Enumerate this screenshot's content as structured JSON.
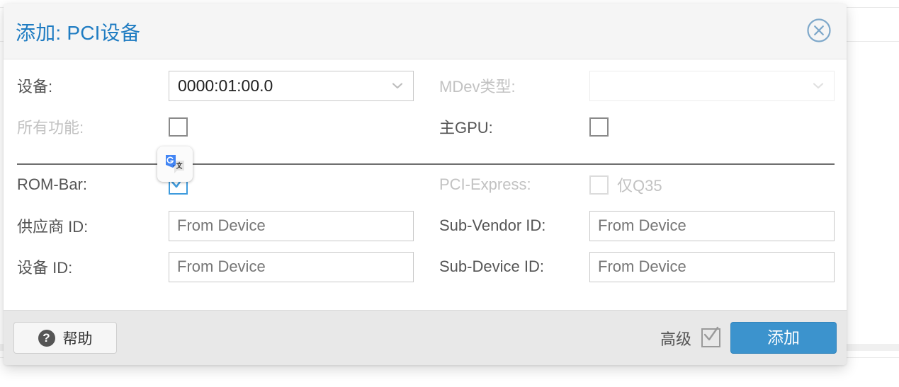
{
  "dialog": {
    "title": "添加: PCI设备",
    "close_icon": "close-circle-icon"
  },
  "form": {
    "device": {
      "label": "设备:",
      "value": "0000:01:00.0",
      "caret_icon": "chevron-down-icon"
    },
    "mdev_type": {
      "label": "MDev类型:",
      "value": "",
      "caret_icon": "chevron-down-icon"
    },
    "all_functions": {
      "label": "所有功能:",
      "checked": false
    },
    "primary_gpu": {
      "label": "主GPU:",
      "checked": false
    },
    "rom_bar": {
      "label": "ROM-Bar:",
      "checked": true
    },
    "pci_express": {
      "label": "PCI-Express:",
      "suffix": "仅Q35",
      "checked": false
    },
    "vendor_id": {
      "label": "供应商 ID:",
      "value": "",
      "placeholder": "From Device"
    },
    "sub_vendor_id": {
      "label": "Sub-Vendor ID:",
      "value": "",
      "placeholder": "From Device"
    },
    "device_id": {
      "label": "设备 ID:",
      "value": "",
      "placeholder": "From Device"
    },
    "sub_device_id": {
      "label": "Sub-Device ID:",
      "value": "",
      "placeholder": "From Device"
    }
  },
  "footer": {
    "help_label": "帮助",
    "help_icon": "question-mark-icon",
    "advanced_label": "高级",
    "advanced_checked": true,
    "add_label": "添加"
  },
  "overlay": {
    "translate_icon": "google-translate-icon"
  },
  "colors": {
    "title_blue": "#1f7cc2",
    "accent_blue": "#3c93cd",
    "checkbox_blue": "#3e9bdd",
    "muted_gray": "#c2c2c2",
    "header_bg": "#f5f5f5",
    "footer_bg": "#e8e8e8"
  }
}
